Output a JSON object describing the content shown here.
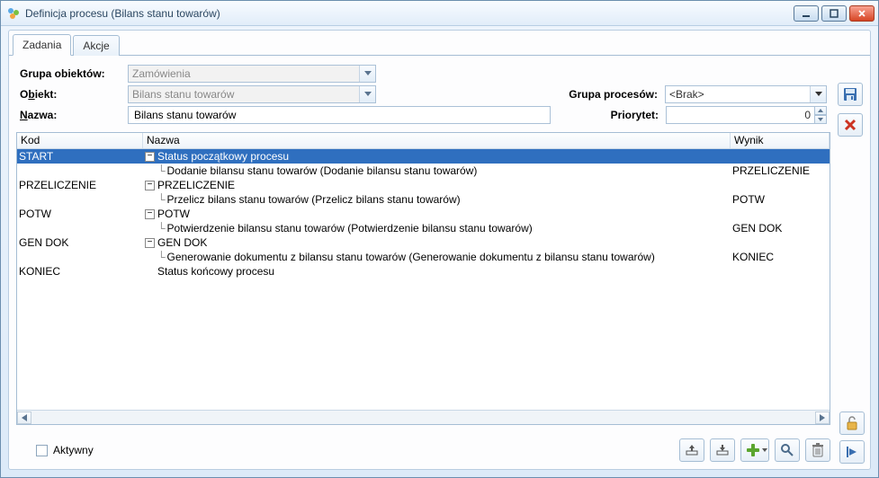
{
  "window": {
    "title": "Definicja procesu (Bilans stanu towarów)"
  },
  "tabs": {
    "tasks": "Zadania",
    "actions": "Akcje"
  },
  "form": {
    "group_label": "Grupa obiektów:",
    "group_value": "Zamówienia",
    "object_label_pre": "O",
    "object_label_u": "b",
    "object_label_post": "iekt:",
    "object_value": "Bilans stanu towarów",
    "name_label_u": "N",
    "name_label_post": "azwa:",
    "name_value": "Bilans stanu towarów",
    "procgroup_label_pre": "Grupa proc",
    "procgroup_label_u": "e",
    "procgroup_label_post": "sów:",
    "procgroup_value": "<Brak>",
    "priority_label_u": "P",
    "priority_label_post": "riorytet:",
    "priority_value": "0"
  },
  "grid": {
    "headers": {
      "kod": "Kod",
      "nazwa": "Nazwa",
      "wynik": "Wynik"
    },
    "rows": [
      {
        "kod": "START",
        "nazwa": "Status początkowy procesu",
        "wynik": "",
        "level": 0,
        "expand": "-",
        "selected": true
      },
      {
        "kod": "",
        "nazwa": "Dodanie bilansu stanu towarów (Dodanie bilansu stanu towarów)",
        "wynik": "PRZELICZENIE",
        "level": 1
      },
      {
        "kod": "PRZELICZENIE",
        "nazwa": "PRZELICZENIE",
        "wynik": "",
        "level": 0,
        "expand": "-"
      },
      {
        "kod": "",
        "nazwa": "Przelicz bilans stanu towarów (Przelicz bilans stanu towarów)",
        "wynik": "POTW",
        "level": 1
      },
      {
        "kod": "POTW",
        "nazwa": "POTW",
        "wynik": "",
        "level": 0,
        "expand": "-"
      },
      {
        "kod": "",
        "nazwa": "Potwierdzenie bilansu stanu towarów (Potwierdzenie bilansu stanu towarów)",
        "wynik": "GEN DOK",
        "level": 1
      },
      {
        "kod": "GEN DOK",
        "nazwa": "GEN DOK",
        "wynik": "",
        "level": 0,
        "expand": "-"
      },
      {
        "kod": "",
        "nazwa": "Generowanie dokumentu z bilansu stanu towarów (Generowanie dokumentu z bilansu stanu towarów)",
        "wynik": "KONIEC",
        "level": 1
      },
      {
        "kod": "KONIEC",
        "nazwa": "Status końcowy procesu",
        "wynik": "",
        "level": 0
      }
    ]
  },
  "bottom": {
    "active_label_u": "A",
    "active_label_post": "ktywny"
  }
}
